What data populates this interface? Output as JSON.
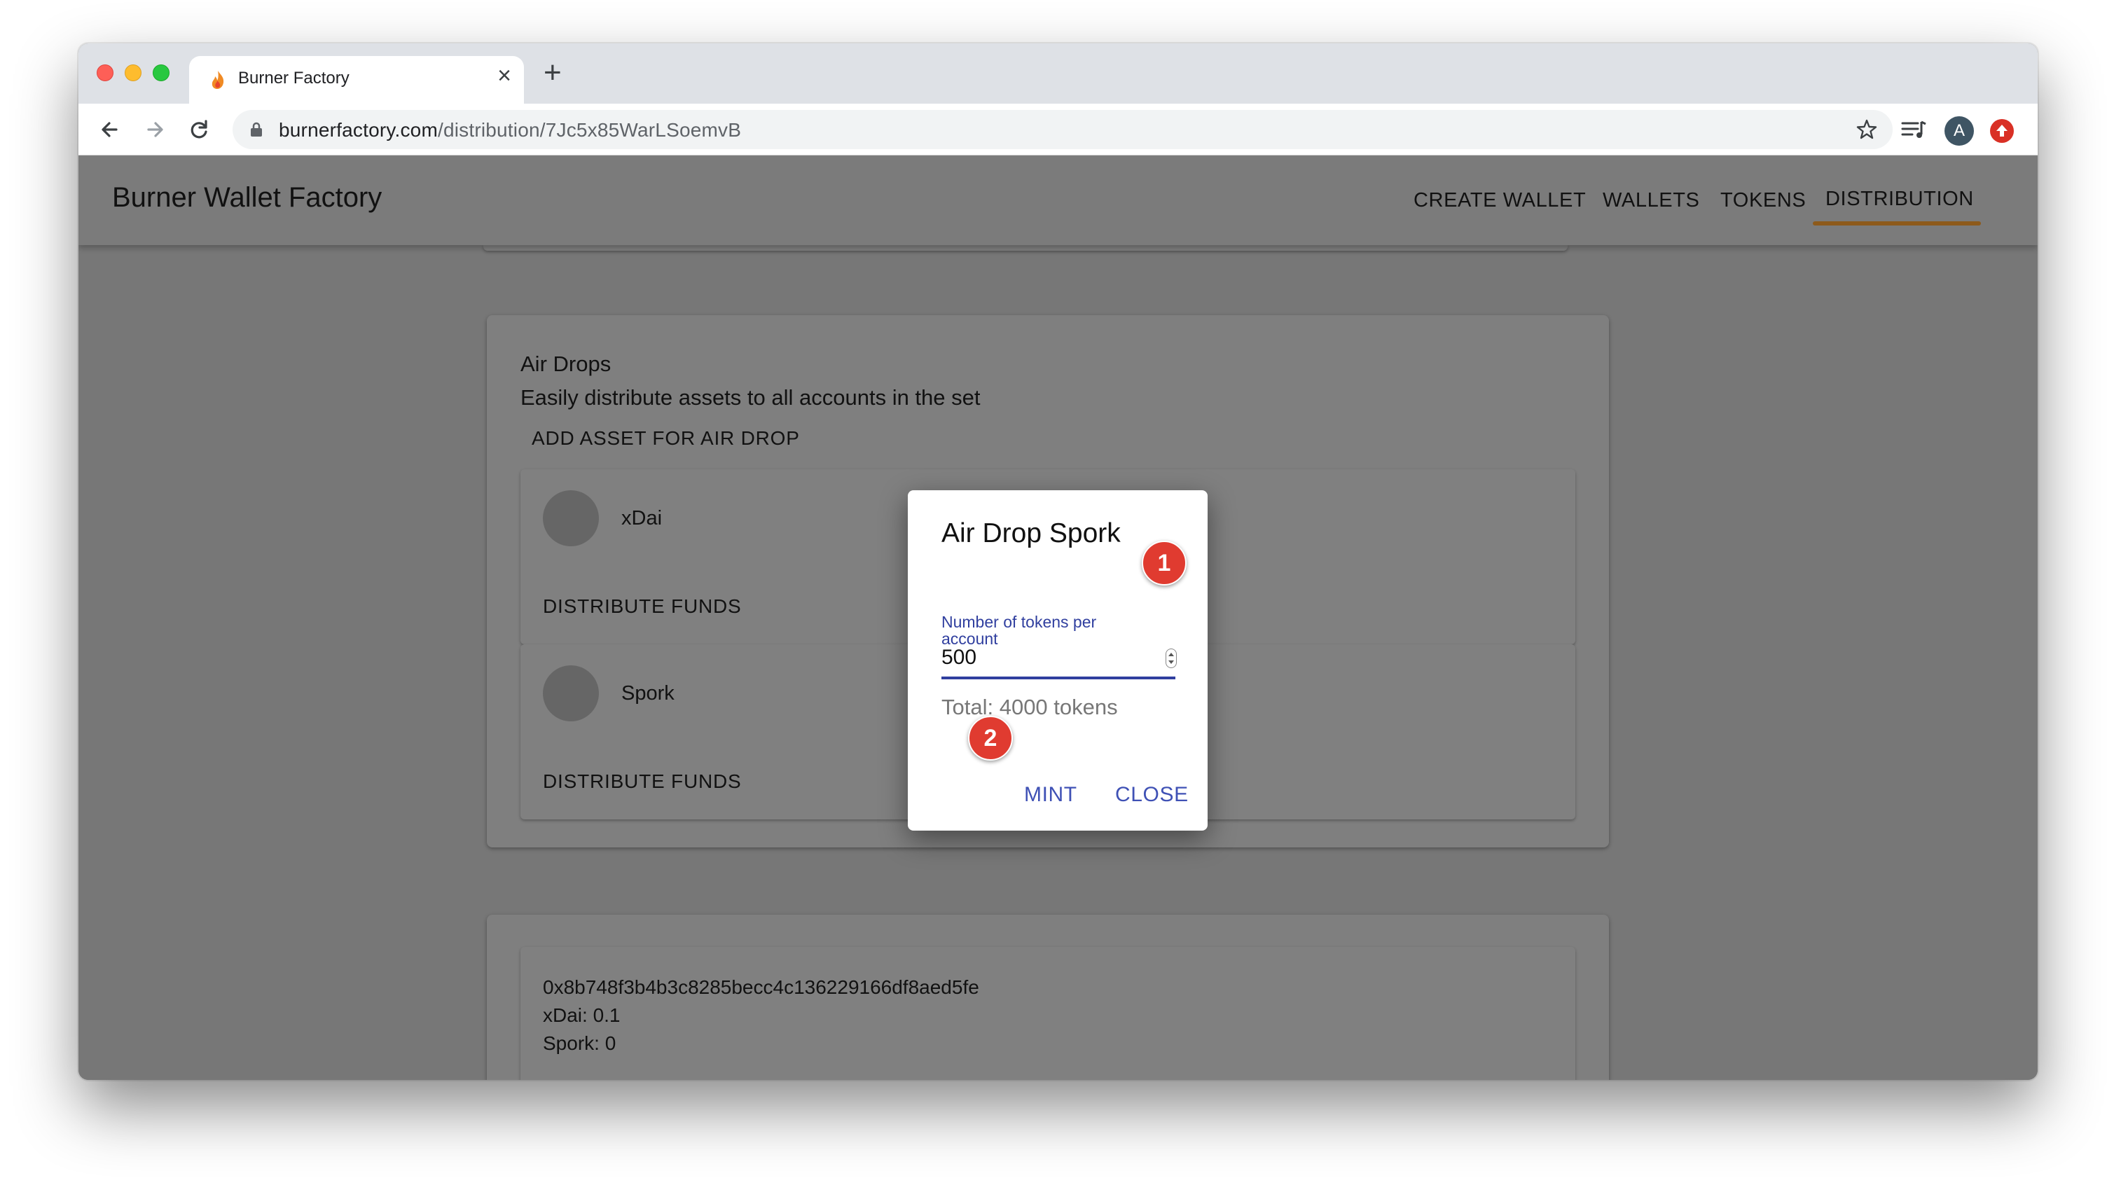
{
  "browser": {
    "tab_title": "Burner Factory",
    "tab_close": "×",
    "new_tab": "+",
    "url_domain": "burnerfactory.com",
    "url_path": "/distribution/7Jc5x85WarLSoemvB",
    "profile_initial": "A"
  },
  "app": {
    "title": "Burner Wallet Factory",
    "nav": [
      "CREATE WALLET",
      "WALLETS",
      "TOKENS",
      "DISTRIBUTION"
    ],
    "active_nav": "DISTRIBUTION",
    "accent_color": "#8d5a1b"
  },
  "airdrops": {
    "title": "Air Drops",
    "subtitle": "Easily distribute assets to all accounts in the set",
    "add_asset_label": "ADD ASSET FOR AIR DROP",
    "assets": [
      {
        "name": "xDai",
        "action": "DISTRIBUTE FUNDS"
      },
      {
        "name": "Spork",
        "action": "DISTRIBUTE FUNDS"
      }
    ]
  },
  "account": {
    "address": "0x8b748f3b4b3c8285becc4c136229166df8aed5fe",
    "balances": [
      "xDai: 0.1",
      "Spork: 0"
    ]
  },
  "dialog": {
    "title": "Air Drop Spork",
    "field_label": "Number of tokens per account",
    "field_value": "500",
    "total": "Total: 4000 tokens",
    "mint_label": "MINT",
    "close_label": "CLOSE",
    "button_color": "#3f51b5"
  },
  "annotations": [
    "1",
    "2"
  ]
}
